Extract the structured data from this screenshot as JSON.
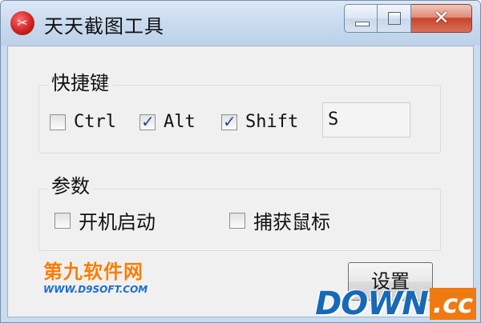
{
  "window": {
    "title": "天天截图工具"
  },
  "hotkey": {
    "group_label": "快捷键",
    "ctrl": {
      "label": "Ctrl",
      "checked": false
    },
    "alt": {
      "label": "Alt",
      "checked": true
    },
    "shift": {
      "label": "Shift",
      "checked": true
    },
    "key_value": "S"
  },
  "params": {
    "group_label": "参数",
    "autostart": {
      "label": "开机启动",
      "checked": false
    },
    "capture_cursor": {
      "label": "捕获鼠标",
      "checked": false
    }
  },
  "settings_button": "设置",
  "watermarks": {
    "d9_main": "第九软件网",
    "d9_sub": "WWW.D9SOFT.COM",
    "downcc_main": "DOWN",
    "downcc_suffix": ".cc"
  },
  "colors": {
    "title_bar": "#c7d9ee",
    "client_bg": "#f0f0f0",
    "close_button": "#c9452a",
    "check_mark": "#2a4a8c",
    "d9_orange": "#ff7a00",
    "downcc_blue": "#1769b8",
    "downcc_orange": "#f07a12"
  },
  "icons": {
    "app": "scissors-icon",
    "minimize": "minimize-icon",
    "maximize": "maximize-icon",
    "close": "close-icon"
  }
}
